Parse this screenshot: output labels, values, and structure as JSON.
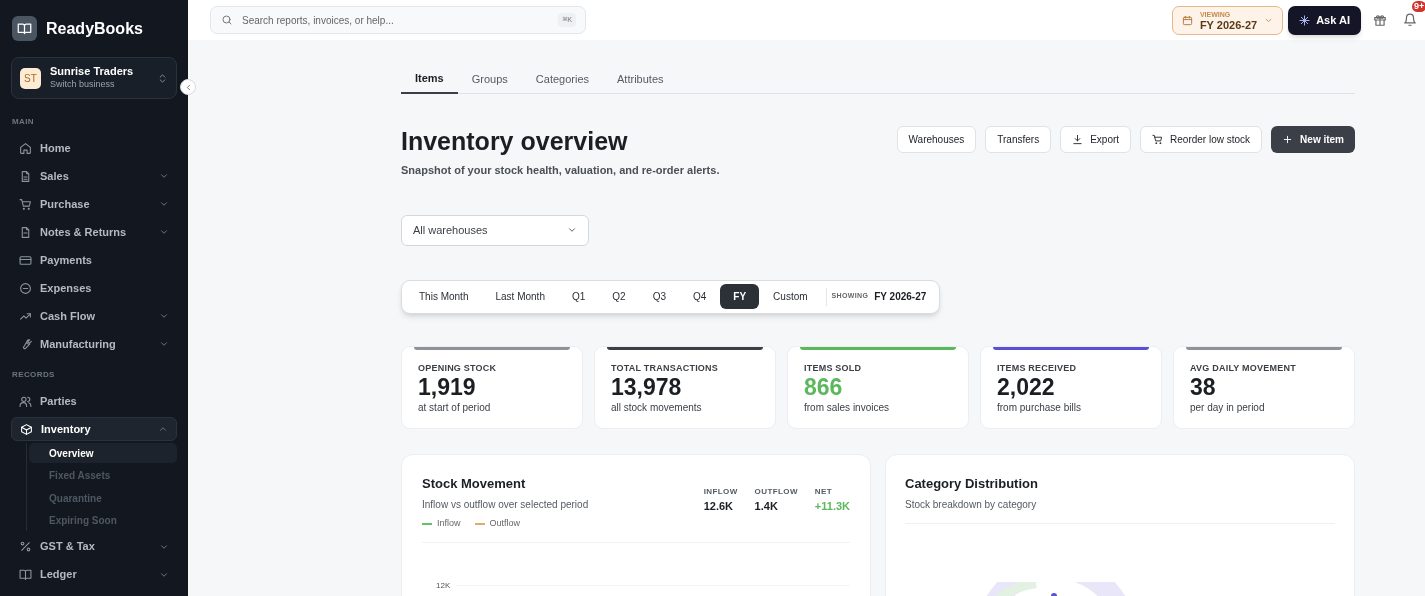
{
  "app": {
    "name": "ReadyBooks"
  },
  "business": {
    "initials": "ST",
    "name": "Sunrise Traders",
    "hint": "Switch business"
  },
  "sidebar": {
    "sections": [
      {
        "heading": "MAIN",
        "items": [
          {
            "label": "Home",
            "expandable": false,
            "selected": false
          },
          {
            "label": "Sales",
            "expandable": true,
            "expanded": false,
            "selected": false
          },
          {
            "label": "Purchase",
            "expandable": true,
            "expanded": false,
            "selected": false
          },
          {
            "label": "Notes & Returns",
            "expandable": true,
            "expanded": false,
            "selected": false
          },
          {
            "label": "Payments",
            "expandable": false,
            "selected": false
          },
          {
            "label": "Expenses",
            "expandable": false,
            "selected": false
          },
          {
            "label": "Cash Flow",
            "expandable": true,
            "expanded": false,
            "selected": false
          },
          {
            "label": "Manufacturing",
            "expandable": true,
            "expanded": false,
            "selected": false
          }
        ]
      },
      {
        "heading": "RECORDS",
        "items": [
          {
            "label": "Parties",
            "expandable": false,
            "selected": false
          },
          {
            "label": "Inventory",
            "expandable": true,
            "expanded": true,
            "selected": true,
            "children": [
              {
                "label": "Overview",
                "selected": true
              },
              {
                "label": "Fixed Assets",
                "selected": false
              },
              {
                "label": "Quarantine",
                "selected": false
              },
              {
                "label": "Expiring Soon",
                "selected": false
              }
            ]
          },
          {
            "label": "GST & Tax",
            "expandable": true,
            "expanded": false,
            "selected": false
          },
          {
            "label": "Ledger",
            "expandable": true,
            "expanded": false,
            "selected": false
          }
        ]
      }
    ]
  },
  "topbar": {
    "search": {
      "placeholder": "Search reports, invoices, or help...",
      "shortcut": "⌘K"
    },
    "period": {
      "label": "VIEWING",
      "value": "FY 2026-27"
    },
    "ask_ai": "Ask AI",
    "notifications": {
      "badge": "9+"
    }
  },
  "tabs": [
    {
      "label": "Items",
      "selected": true
    },
    {
      "label": "Groups",
      "selected": false
    },
    {
      "label": "Categories",
      "selected": false
    },
    {
      "label": "Attributes",
      "selected": false
    }
  ],
  "header": {
    "title": "Inventory overview",
    "subtitle": "Snapshot of your stock health, valuation, and re-order alerts.",
    "actions": [
      {
        "label": "Warehouses",
        "kind": "plain"
      },
      {
        "label": "Transfers",
        "kind": "plain"
      },
      {
        "label": "Export",
        "kind": "download"
      },
      {
        "label": "Reorder low stock",
        "kind": "cart"
      },
      {
        "label": "New item",
        "kind": "primary"
      }
    ]
  },
  "warehouse_select": {
    "value": "All warehouses"
  },
  "periods": {
    "options": [
      {
        "label": "This Month",
        "selected": false
      },
      {
        "label": "Last Month",
        "selected": false
      },
      {
        "label": "Q1",
        "selected": false
      },
      {
        "label": "Q2",
        "selected": false
      },
      {
        "label": "Q3",
        "selected": false
      },
      {
        "label": "Q4",
        "selected": false
      },
      {
        "label": "FY",
        "selected": true
      },
      {
        "label": "Custom",
        "selected": false
      }
    ],
    "showing_label": "SHOWING",
    "showing_value": "FY 2026-27"
  },
  "stats": [
    {
      "label": "OPENING STOCK",
      "value": "1,919",
      "note": "at start of period",
      "color": "#8e9299",
      "highlight": false
    },
    {
      "label": "TOTAL TRANSACTIONS",
      "value": "13,978",
      "note": "all stock movements",
      "color": "#3b4048",
      "highlight": false
    },
    {
      "label": "ITEMS SOLD",
      "value": "866",
      "note": "from sales invoices",
      "color": "#5cb85c",
      "highlight": true
    },
    {
      "label": "ITEMS RECEIVED",
      "value": "2,022",
      "note": "from purchase bills",
      "color": "#5b4fd6",
      "highlight": false
    },
    {
      "label": "AVG DAILY MOVEMENT",
      "value": "38",
      "note": "per day in period",
      "color": "#8e9299",
      "highlight": false
    }
  ],
  "stock_movement": {
    "title": "Stock Movement",
    "subtitle": "Inflow vs outflow over selected period",
    "legend": [
      {
        "label": "Inflow",
        "color": "#6abf69"
      },
      {
        "label": "Outflow",
        "color": "#e0a96d"
      }
    ],
    "totals": [
      {
        "label": "INFLOW",
        "value": "12.6K",
        "positive": false
      },
      {
        "label": "OUTFLOW",
        "value": "1.4K",
        "positive": false
      },
      {
        "label": "NET",
        "value": "+11.3K",
        "positive": true
      }
    ],
    "axis_label": "12K"
  },
  "category_distribution": {
    "title": "Category Distribution",
    "subtitle": "Stock breakdown by category"
  }
}
